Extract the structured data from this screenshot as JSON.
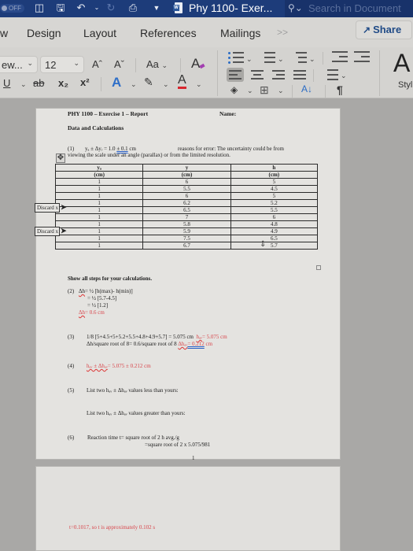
{
  "titlebar": {
    "autosave_label": "OFF",
    "doc_title": "Phy 1100- Exer...",
    "search_placeholder": "Search in Document",
    "icons": [
      "sidebar-icon",
      "save-icon",
      "undo-icon",
      "redo-icon",
      "print-icon",
      "customize-icon"
    ]
  },
  "ribbon_tabs": {
    "tabs": [
      "w",
      "Design",
      "Layout",
      "References",
      "Mailings"
    ],
    "more": ">>",
    "share_label": "Share"
  },
  "ribbon": {
    "font_name": "ew...",
    "font_size": "12",
    "grow_font": "Aˆ",
    "shrink_font": "Aˇ",
    "change_case": "Aa",
    "clear_format": "A",
    "underline": "U",
    "strikethrough": "ab",
    "subscript": "x₂",
    "superscript": "x²",
    "text_effects": "A",
    "font_color": "A",
    "font_color_hex": "#d8262e",
    "sort": "A↓",
    "pilcrow": "¶",
    "styles_label": "Styl"
  },
  "document": {
    "header_title": "PHY 1100 – Exercise 1 – Report",
    "name_label": "Name:",
    "section_title": "Data and Calculations",
    "q1_num": "(1)",
    "q1_formula": "yₐ ± Δyᵣ = 1.0 ",
    "q1_unc": "± 0.1",
    "q1_unit": " cm",
    "q1_reason": "reasons for error: The uncertainty could be from",
    "q1_reason_cont": "viewing the scale under an angle (parallax) or from the limited resolution.",
    "table": {
      "headers": [
        "yₐ",
        "y",
        "h"
      ],
      "units": [
        "(cm)",
        "(cm)",
        "(cm)"
      ],
      "rows": [
        [
          "1",
          "6",
          "5"
        ],
        [
          "1",
          "5.5",
          "4.5"
        ],
        [
          "1",
          "6",
          "5"
        ],
        [
          "1",
          "6.2",
          "5.2"
        ],
        [
          "1",
          "6.5",
          "5.5"
        ],
        [
          "1",
          "7",
          "6"
        ],
        [
          "1",
          "5.8",
          "4.8"
        ],
        [
          "1",
          "5.9",
          "4.9"
        ],
        [
          "1",
          "7.5",
          "6.5"
        ],
        [
          "1",
          "6.7",
          "5.7"
        ]
      ]
    },
    "callouts": [
      "Discard x",
      "Discard x"
    ],
    "show_steps": "Show all steps for your calculations.",
    "q2_num": "(2)",
    "q2_sym": "Δh",
    "q2_line1": "= ½ [h(max)- h(min)]",
    "q2_line2": "= ½ [5.7-4.5]",
    "q2_line3": "= ½ [1.2]",
    "q2_result": "= 0.6 cm",
    "q3_num": "(3)",
    "q3_line1": "1/8 [5+4.5+5+5.2+5.5+4.8+4.9+5.7] = 5.075 cm",
    "q3_havg": "hₐᵥ",
    "q3_havg_val": "= 5.075 cm",
    "q3_line2": "Δh/square root of 8= 0.6/square root of 8 ",
    "q3_dh": "Δhₐᵥ",
    "q3_dh_val": "= 0.212",
    "q3_dh_unit": " cm",
    "q4_num": "(4)",
    "q4_lhs": "hₐᵥ ± Δhₐᵥ",
    "q4_val": "= 5.075 ± 0.212 cm",
    "q5_num": "(5)",
    "q5_line1": "List two hₐᵥ ± Δhₐᵥ values less than yours:",
    "q5_line2": "List two hₐᵥ ± Δhₐᵥ values greater than yours:",
    "q6_num": "(6)",
    "q6_line1": "Reaction time t= square root of 2 h avg./g",
    "q6_line2": "=square root of 2 x 5.075/981",
    "q6_cursor_char": "1",
    "page2_result": "t=0.1017, so t is approximately 0.102 s"
  }
}
